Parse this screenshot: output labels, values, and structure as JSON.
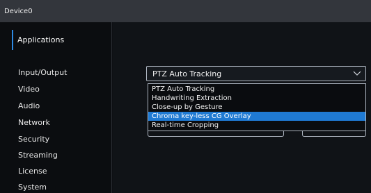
{
  "window": {
    "title": "Device0"
  },
  "sidebar": {
    "applications_label": "Applications",
    "items": [
      {
        "label": "Input/Output"
      },
      {
        "label": "Video"
      },
      {
        "label": "Audio"
      },
      {
        "label": "Network"
      },
      {
        "label": "Security"
      },
      {
        "label": "Streaming"
      },
      {
        "label": "License"
      },
      {
        "label": "System"
      }
    ]
  },
  "app_select": {
    "selected_value": "PTZ Auto Tracking",
    "options": [
      {
        "label": "PTZ Auto Tracking"
      },
      {
        "label": "Handwriting Extraction"
      },
      {
        "label": "Close-up by Gesture"
      },
      {
        "label": "Chroma key-less CG Overlay"
      },
      {
        "label": "Real-time Cropping"
      }
    ],
    "highlighted_option": "Chroma key-less CG Overlay"
  },
  "colors": {
    "accent": "#2d8ae3",
    "highlight": "#1f7ad3",
    "titlebar": "#33363c",
    "background": "#0e1014"
  },
  "icons": {
    "select_chevron": "chevron-down-icon"
  }
}
